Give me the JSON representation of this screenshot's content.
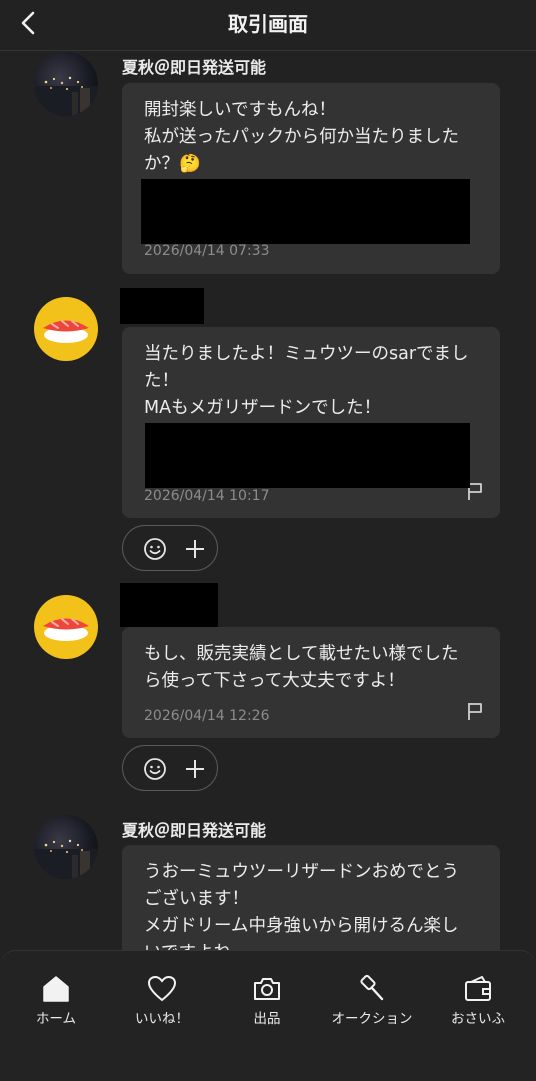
{
  "header": {
    "title": "取引画面",
    "back_icon": "chevron-left-icon"
  },
  "messages": [
    {
      "sender": "夏秋＠即日発送可能",
      "text": "開封楽しいですもんね！\n私が送ったパックから何か当たりましたか？🤔",
      "timestamp": "2026/04/14 07:33",
      "avatar": "night-city-photo"
    },
    {
      "sender": "",
      "text": "当たりましたよ！ミュウツーのsarでました！\nMAもメガリザードンでした！",
      "timestamp": "2026/04/14 10:17",
      "avatar": "sushi-icon"
    },
    {
      "sender": "",
      "text": "もし、販売実績として載せたい様でしたら使って下さって大丈夫ですよ！",
      "timestamp": "2026/04/14 12:26",
      "avatar": "sushi-icon"
    },
    {
      "sender": "夏秋＠即日発送可能",
      "text": "うおーミュウツーリザードンおめでとうございます！\nメガドリーム中身強いから開けるん楽しいですよね",
      "avatar": "night-city-photo"
    }
  ],
  "nav": [
    {
      "label": "ホーム",
      "icon": "home-icon"
    },
    {
      "label": "いいね！",
      "icon": "heart-icon"
    },
    {
      "label": "出品",
      "icon": "camera-icon"
    },
    {
      "label": "オークション",
      "icon": "gavel-icon"
    },
    {
      "label": "おさいふ",
      "icon": "wallet-icon"
    }
  ]
}
